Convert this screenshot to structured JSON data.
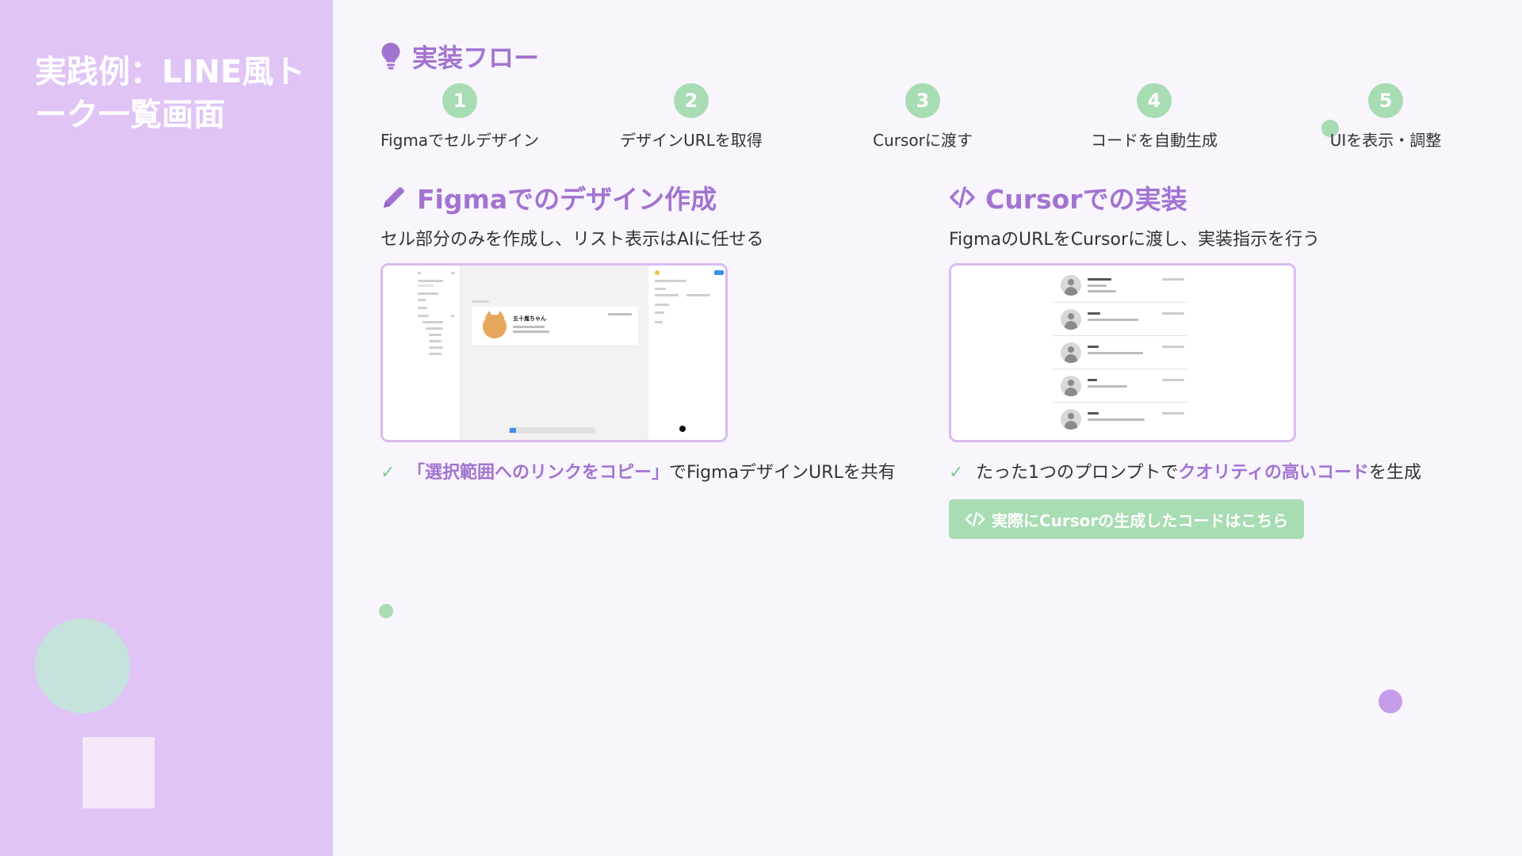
{
  "sidebar": {
    "title": "実践例：LINE風トーク一覧画面"
  },
  "flow": {
    "heading": "実装フロー",
    "steps": [
      {
        "num": "1",
        "label": "Figmaでセルデザイン"
      },
      {
        "num": "2",
        "label": "デザインURLを取得"
      },
      {
        "num": "3",
        "label": "Cursorに渡す"
      },
      {
        "num": "4",
        "label": "コードを自動生成"
      },
      {
        "num": "5",
        "label": "UIを表示・調整"
      }
    ]
  },
  "figma": {
    "heading": "Figmaでのデザイン作成",
    "subtitle": "セル部分のみを作成し、リスト表示はAIに任せる",
    "mock_cell_name": "五十嵐ちゃん",
    "check": {
      "mark": "✓",
      "highlight": "「選択範囲へのリンクをコピー」",
      "rest": "でFigmaデザインURLを共有"
    }
  },
  "cursor": {
    "heading": "Cursorでの実装",
    "subtitle": "FigmaのURLをCursorに渡し、実装指示を行う",
    "check": {
      "mark": "✓",
      "pre": "たった1つのプロンプトで",
      "highlight": "クオリティの高いコード",
      "post": "を生成"
    },
    "button_label": "実際にCursorの生成したコードはこちら"
  },
  "colors": {
    "sidebar_bg": "#dfc4f5",
    "accent_purple": "#a274d1",
    "accent_green": "#a8dcb3",
    "page_bg": "#f8f5fc"
  },
  "icons": {
    "flow_heading": "lightbulb-icon",
    "figma_heading": "pencil-icon",
    "cursor_heading": "code-icon",
    "check": "check-icon",
    "button": "code-icon"
  }
}
